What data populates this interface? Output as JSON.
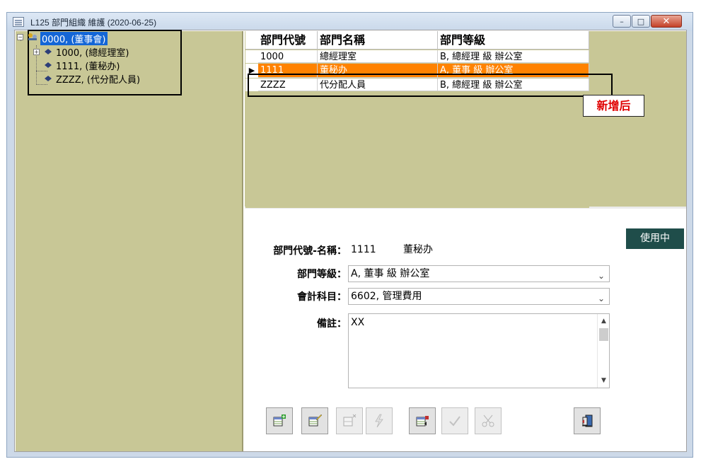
{
  "window": {
    "title": "L125 部門組織 維護 (2020-06-25)",
    "controls": {
      "minimize": "–",
      "maximize": "□",
      "close": "✕"
    }
  },
  "tree": {
    "root": {
      "label": "0000, (董事會)",
      "selected": true,
      "expander": "−"
    },
    "children": [
      {
        "label": "1000, (總經理室)",
        "expander": "+"
      },
      {
        "label": "1111, (董秘办)"
      },
      {
        "label": "ZZZZ, (代分配人員)"
      }
    ]
  },
  "grid": {
    "headers": [
      "部門代號",
      "部門名稱",
      "部門等級"
    ],
    "rows": [
      {
        "code": "1000",
        "name": "總經理室",
        "level": "B, 總經理 級 辦公室",
        "selected": false
      },
      {
        "code": "1111",
        "name": "董秘办",
        "level": "A, 董事 級 辦公室",
        "selected": true
      },
      {
        "code": "ZZZZ",
        "name": "代分配人員",
        "level": "B, 總經理 級 辦公室",
        "selected": false
      }
    ],
    "current_row_marker": "▶"
  },
  "annotation": {
    "new_after": "新增后"
  },
  "form": {
    "status": "使用中",
    "dept_code_label": "部門代號-名稱：",
    "dept_code": "1111",
    "dept_name": "董秘办",
    "dept_level_label": "部門等級：",
    "dept_level": "A, 董事 級 辦公室",
    "account_label": "會計科目：",
    "account": "6602, 管理費用",
    "memo_label": "備註：",
    "memo": "XX"
  },
  "toolbar": {
    "buttons": [
      {
        "name": "add",
        "enabled": true
      },
      {
        "name": "edit",
        "enabled": true
      },
      {
        "name": "delete",
        "enabled": false
      },
      {
        "name": "lightning",
        "enabled": false
      },
      {
        "name": "query",
        "enabled": true
      },
      {
        "name": "confirm",
        "enabled": false
      },
      {
        "name": "cancel",
        "enabled": false
      },
      {
        "name": "exit",
        "enabled": true
      }
    ]
  },
  "colors": {
    "tree_bg": "#c8c796",
    "selected_row": "#ff8200",
    "tree_selection": "#1466d6",
    "status_badge": "#1f4d4a",
    "annotation_text": "#e00000"
  }
}
